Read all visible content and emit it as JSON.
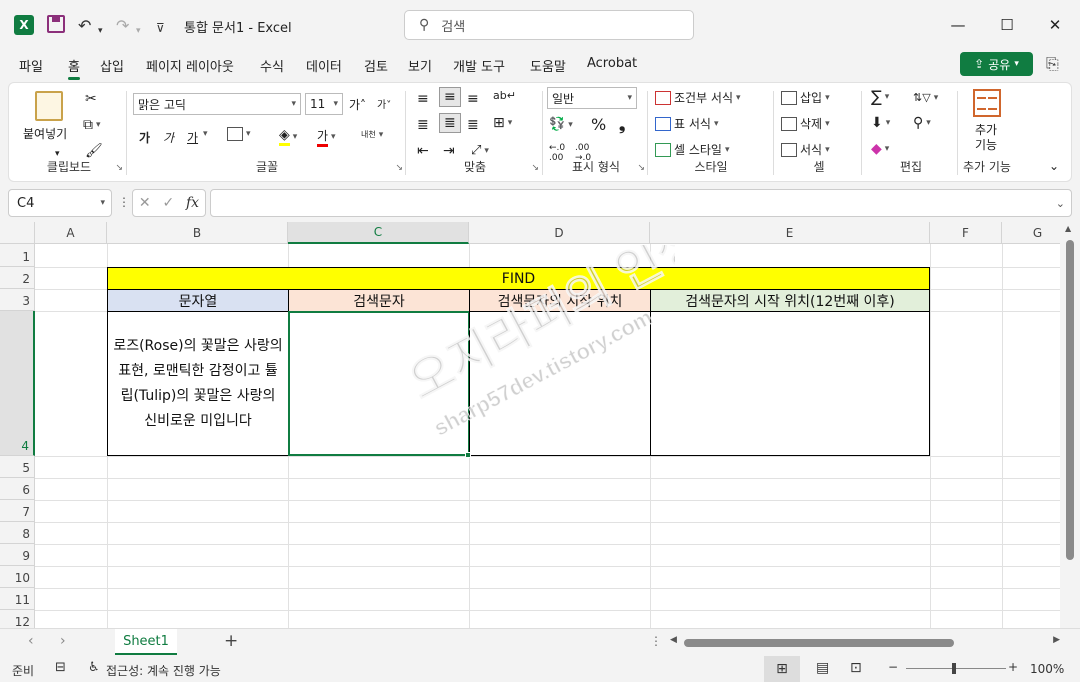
{
  "titlebar": {
    "logo": "X",
    "title": "통합 문서1  -  Excel",
    "search_placeholder": "검색",
    "minimize": "—",
    "maximize": "☐",
    "close": "✕",
    "undo": "↶",
    "redo": "↷",
    "qa_more": "⊽"
  },
  "menu": {
    "items": [
      "파일",
      "홈",
      "삽입",
      "페이지 레이아웃",
      "수식",
      "데이터",
      "검토",
      "보기",
      "개발 도구",
      "도움말",
      "Acrobat"
    ],
    "active": "홈",
    "share": "공유"
  },
  "ribbon": {
    "clipboard": {
      "label": "클립보드",
      "paste": "붙여넣기"
    },
    "font": {
      "label": "글꼴",
      "font_name": "맑은 고딕",
      "font_size": "11",
      "bold": "가",
      "italic": "가",
      "underline": "가",
      "font_color": "가",
      "grow": "가˄",
      "shrink": "가˅",
      "phonetic": "내천"
    },
    "align": {
      "label": "맞춤"
    },
    "number": {
      "label": "표시 형식",
      "format": "일반",
      "percent": "%",
      "comma": "❟"
    },
    "styles": {
      "label": "스타일",
      "conditional": "조건부 서식",
      "table": "표 서식",
      "cell": "셀 스타일"
    },
    "cells": {
      "label": "셀",
      "insert": "삽입",
      "delete": "삭제",
      "format": "서식"
    },
    "editing": {
      "label": "편집",
      "sum": "∑"
    },
    "addins": {
      "label": "추가 기능",
      "button": "추가\n기능"
    }
  },
  "formula_bar": {
    "name_box": "C4",
    "fx": "fx",
    "formula": ""
  },
  "grid": {
    "columns": [
      "A",
      "B",
      "C",
      "D",
      "E",
      "F",
      "G"
    ],
    "selected_column": "C",
    "rows": [
      "1",
      "2",
      "3",
      "4",
      "5",
      "6",
      "7",
      "8",
      "9",
      "10",
      "11",
      "12"
    ],
    "selected_row": "4",
    "cells": {
      "B2": "FIND",
      "B3": "문자열",
      "C3": "검색문자",
      "D3": "검색문자의 시작 위치",
      "E3": "검색문자의 시작 위치(12번째 이후)",
      "B4": "로즈(Rose)의 꽃말은 사랑의 표현, 로맨틱한 감정이고 튤립(Tulip)의 꽃말은 사랑의 신비로운 미입니다"
    },
    "colors": {
      "find": "#ffff00",
      "b3": "#d9e1f2",
      "c3": "#fce4d6",
      "e3": "#e2efda",
      "accent": "#107c41"
    }
  },
  "watermark": {
    "line1": "오지라퍼의 인생",
    "line2": "sharp57dev.tistory.com"
  },
  "sheets": {
    "tabs": [
      "Sheet1"
    ],
    "add": "+"
  },
  "status": {
    "ready": "준비",
    "accessibility": "접근성: 계속 진행 가능",
    "zoom": "100%",
    "minus": "−",
    "plus": "+"
  }
}
